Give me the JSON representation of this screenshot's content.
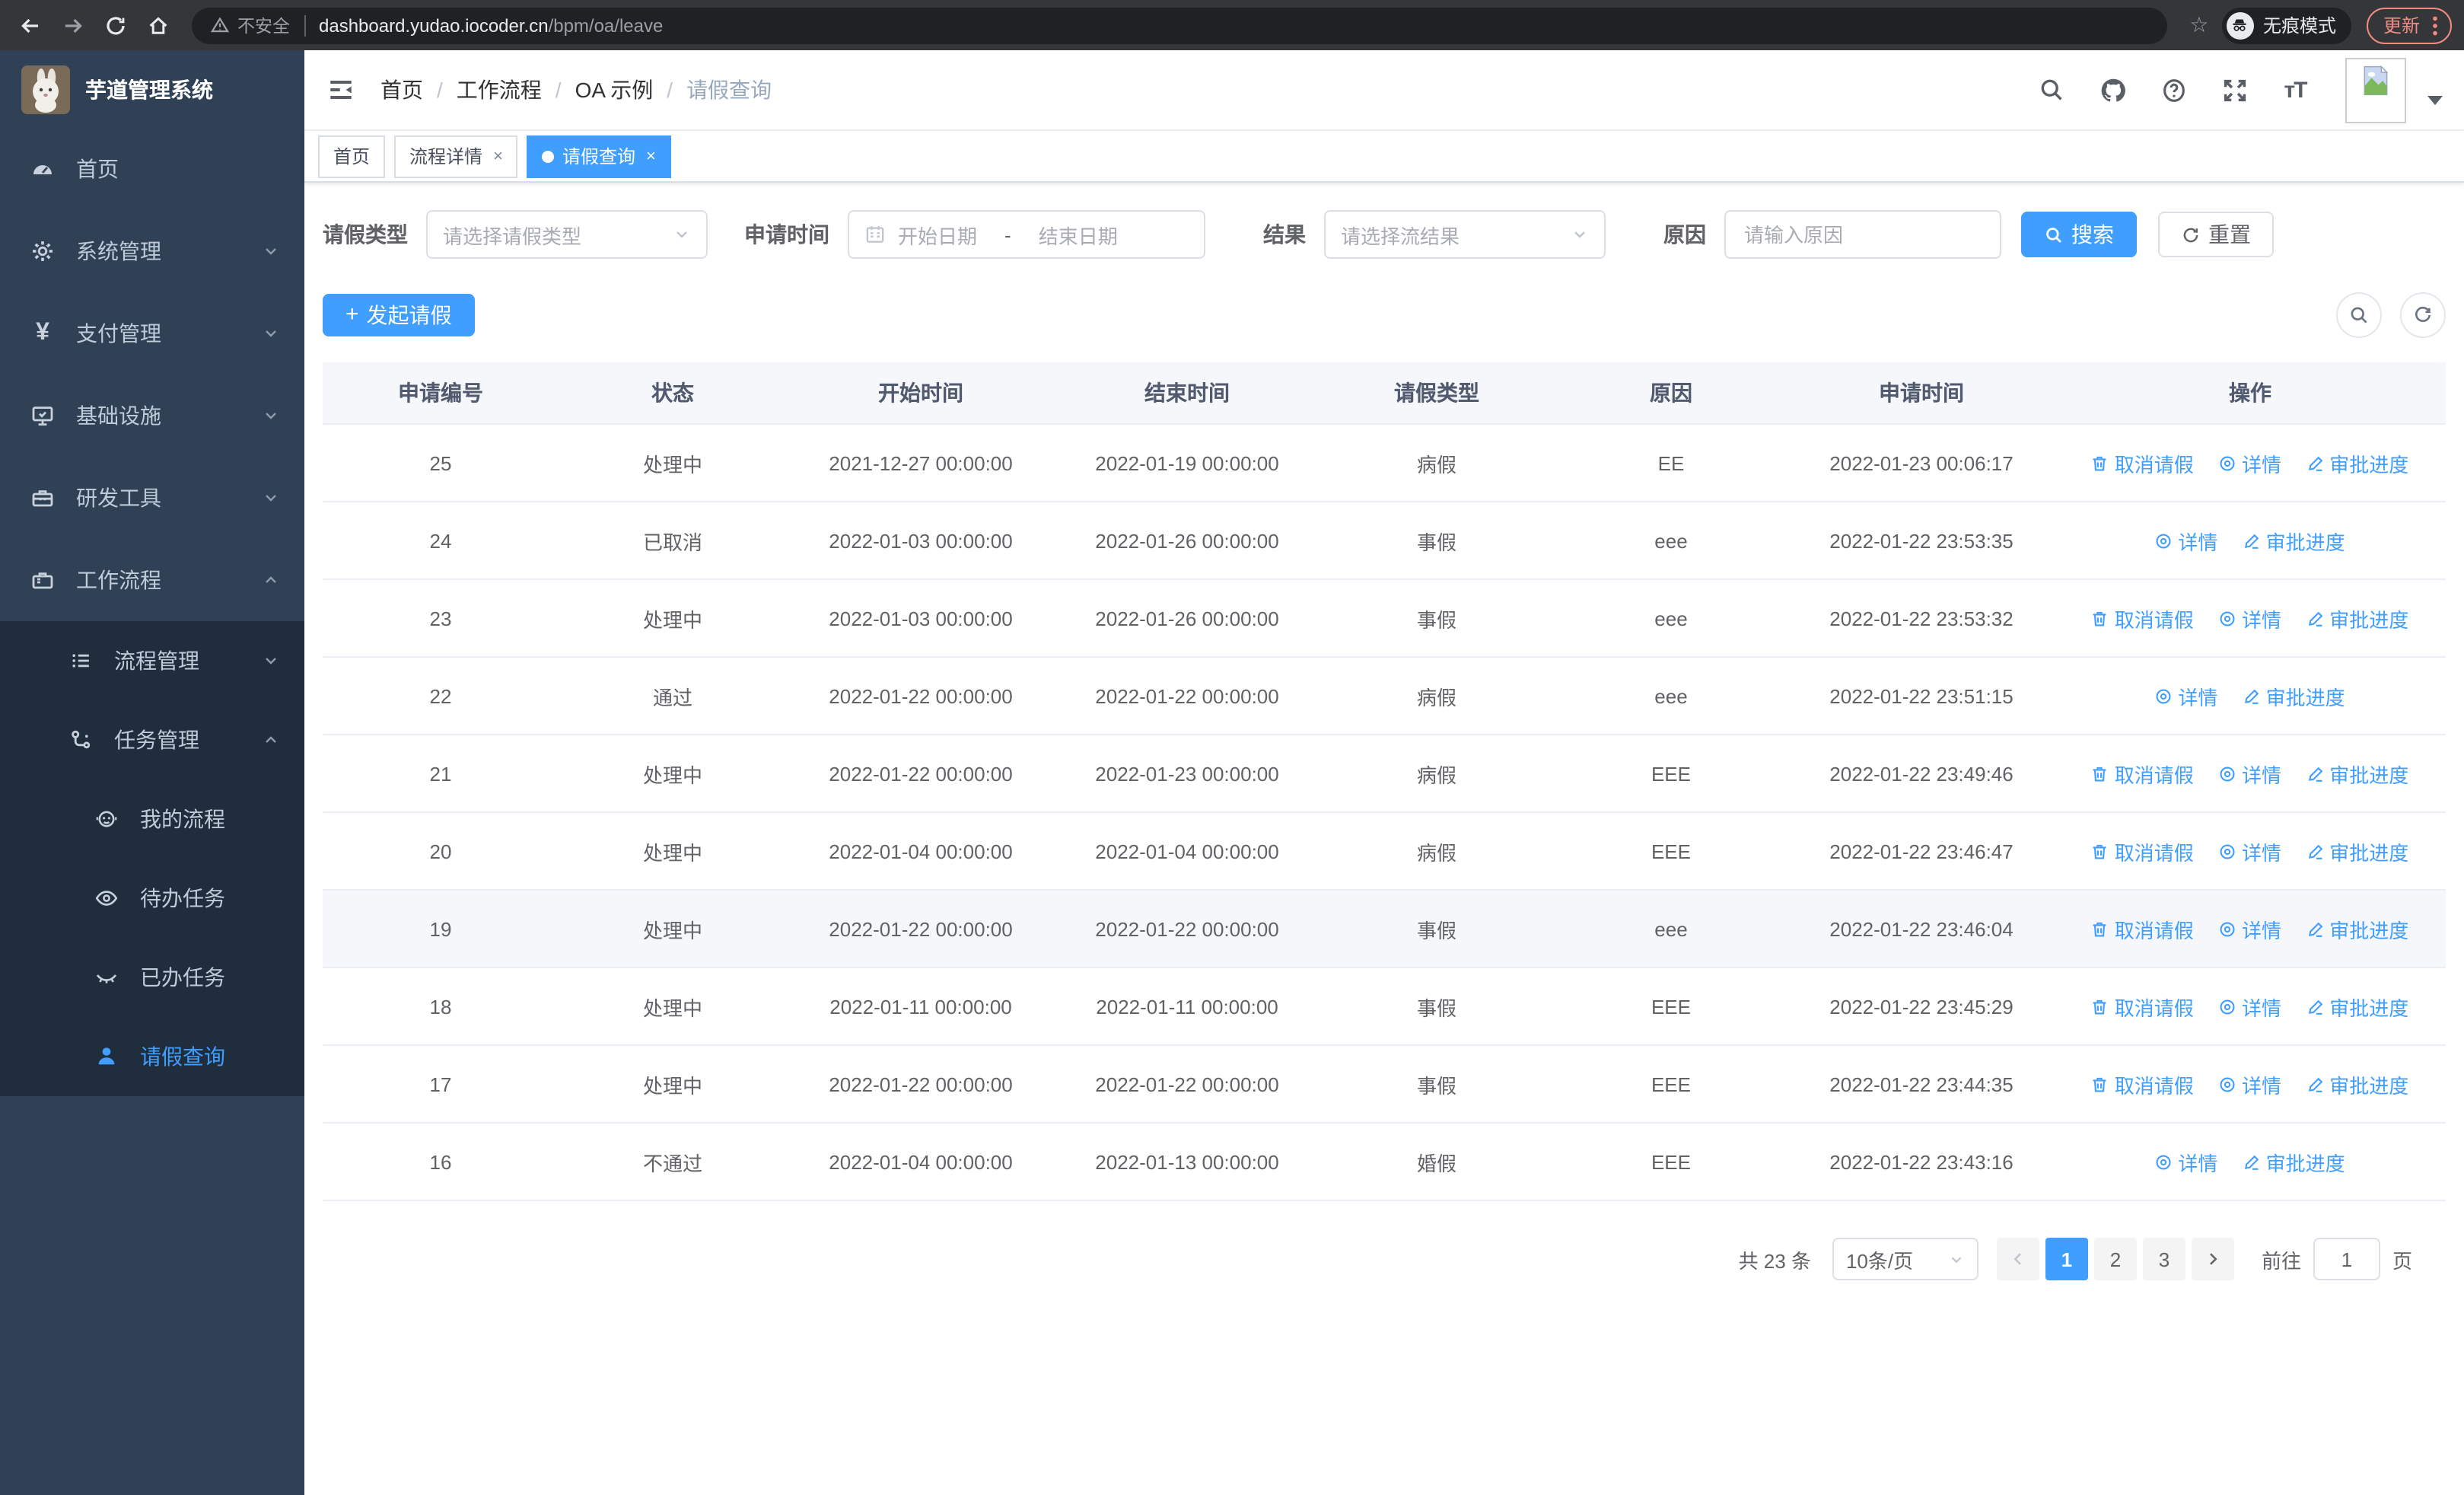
{
  "browser": {
    "security_label": "不安全",
    "url_host": "dashboard.yudao.iocoder.cn",
    "url_path": "/bpm/oa/leave",
    "incognito_label": "无痕模式",
    "update_label": "更新"
  },
  "sidebar": {
    "app_title": "芋道管理系统",
    "items": [
      {
        "label": "首页",
        "icon": "dashboard-icon",
        "level": 1
      },
      {
        "label": "系统管理",
        "icon": "gear-icon",
        "level": 1,
        "chevron": "down"
      },
      {
        "label": "支付管理",
        "icon": "yen-icon",
        "level": 1,
        "chevron": "down"
      },
      {
        "label": "基础设施",
        "icon": "monitor-icon",
        "level": 1,
        "chevron": "down"
      },
      {
        "label": "研发工具",
        "icon": "toolbox-icon",
        "level": 1,
        "chevron": "down"
      },
      {
        "label": "工作流程",
        "icon": "briefcase-icon",
        "level": 1,
        "chevron": "up"
      },
      {
        "label": "流程管理",
        "icon": "process-list-icon",
        "level": 2,
        "chevron": "down"
      },
      {
        "label": "任务管理",
        "icon": "task-flow-icon",
        "level": 2,
        "chevron": "up"
      },
      {
        "label": "我的流程",
        "icon": "my-process-icon",
        "level": 3
      },
      {
        "label": "待办任务",
        "icon": "eye-open-icon",
        "level": 3
      },
      {
        "label": "已办任务",
        "icon": "eye-closed-icon",
        "level": 3
      },
      {
        "label": "请假查询",
        "icon": "user-icon",
        "level": 3,
        "active": true
      }
    ]
  },
  "navbar": {
    "breadcrumb": [
      "首页",
      "工作流程",
      "OA 示例",
      "请假查询"
    ],
    "icons": [
      "search-icon",
      "github-icon",
      "help-icon",
      "fullscreen-icon",
      "font-size-icon",
      "avatar",
      "caret-down-icon"
    ]
  },
  "tabs": [
    {
      "label": "首页",
      "closable": false,
      "active": false
    },
    {
      "label": "流程详情",
      "closable": true,
      "active": false
    },
    {
      "label": "请假查询",
      "closable": true,
      "active": true
    }
  ],
  "filters": {
    "leave_type_label": "请假类型",
    "leave_type_placeholder": "请选择请假类型",
    "apply_time_label": "申请时间",
    "start_date_placeholder": "开始日期",
    "range_separator": "-",
    "end_date_placeholder": "结束日期",
    "result_label": "结果",
    "result_placeholder": "请选择流结果",
    "reason_label": "原因",
    "reason_placeholder": "请输入原因",
    "search_label": "搜索",
    "reset_label": "重置"
  },
  "toolbar": {
    "create_label": "发起请假"
  },
  "table": {
    "columns": [
      "申请编号",
      "状态",
      "开始时间",
      "结束时间",
      "请假类型",
      "原因",
      "申请时间",
      "操作"
    ],
    "action_labels": {
      "cancel": "取消请假",
      "detail": "详情",
      "progress": "审批进度"
    },
    "rows": [
      {
        "id": "25",
        "status": "处理中",
        "start": "2021-12-27 00:00:00",
        "end": "2022-01-19 00:00:00",
        "type": "病假",
        "reason": "EE",
        "apply": "2022-01-23 00:06:17",
        "actions": [
          "cancel",
          "detail",
          "progress"
        ]
      },
      {
        "id": "24",
        "status": "已取消",
        "start": "2022-01-03 00:00:00",
        "end": "2022-01-26 00:00:00",
        "type": "事假",
        "reason": "eee",
        "apply": "2022-01-22 23:53:35",
        "actions": [
          "detail",
          "progress"
        ]
      },
      {
        "id": "23",
        "status": "处理中",
        "start": "2022-01-03 00:00:00",
        "end": "2022-01-26 00:00:00",
        "type": "事假",
        "reason": "eee",
        "apply": "2022-01-22 23:53:32",
        "actions": [
          "cancel",
          "detail",
          "progress"
        ]
      },
      {
        "id": "22",
        "status": "通过",
        "start": "2022-01-22 00:00:00",
        "end": "2022-01-22 00:00:00",
        "type": "病假",
        "reason": "eee",
        "apply": "2022-01-22 23:51:15",
        "actions": [
          "detail",
          "progress"
        ]
      },
      {
        "id": "21",
        "status": "处理中",
        "start": "2022-01-22 00:00:00",
        "end": "2022-01-23 00:00:00",
        "type": "病假",
        "reason": "EEE",
        "apply": "2022-01-22 23:49:46",
        "actions": [
          "cancel",
          "detail",
          "progress"
        ]
      },
      {
        "id": "20",
        "status": "处理中",
        "start": "2022-01-04 00:00:00",
        "end": "2022-01-04 00:00:00",
        "type": "病假",
        "reason": "EEE",
        "apply": "2022-01-22 23:46:47",
        "actions": [
          "cancel",
          "detail",
          "progress"
        ]
      },
      {
        "id": "19",
        "status": "处理中",
        "start": "2022-01-22 00:00:00",
        "end": "2022-01-22 00:00:00",
        "type": "事假",
        "reason": "eee",
        "apply": "2022-01-22 23:46:04",
        "actions": [
          "cancel",
          "detail",
          "progress"
        ],
        "highlighted": true
      },
      {
        "id": "18",
        "status": "处理中",
        "start": "2022-01-11 00:00:00",
        "end": "2022-01-11 00:00:00",
        "type": "事假",
        "reason": "EEE",
        "apply": "2022-01-22 23:45:29",
        "actions": [
          "cancel",
          "detail",
          "progress"
        ]
      },
      {
        "id": "17",
        "status": "处理中",
        "start": "2022-01-22 00:00:00",
        "end": "2022-01-22 00:00:00",
        "type": "事假",
        "reason": "EEE",
        "apply": "2022-01-22 23:44:35",
        "actions": [
          "cancel",
          "detail",
          "progress"
        ]
      },
      {
        "id": "16",
        "status": "不通过",
        "start": "2022-01-04 00:00:00",
        "end": "2022-01-13 00:00:00",
        "type": "婚假",
        "reason": "EEE",
        "apply": "2022-01-22 23:43:16",
        "actions": [
          "detail",
          "progress"
        ]
      }
    ]
  },
  "pagination": {
    "total": "共 23 条",
    "page_size": "10条/页",
    "pages": [
      "1",
      "2",
      "3"
    ],
    "active_page": "1",
    "goto_label": "前往",
    "goto_value": "1",
    "unit_label": "页"
  },
  "colors": {
    "primary": "#409eff",
    "sidebar_bg": "#304156",
    "submenu_bg": "#1f2d3d",
    "update_accent": "#f28b82"
  }
}
